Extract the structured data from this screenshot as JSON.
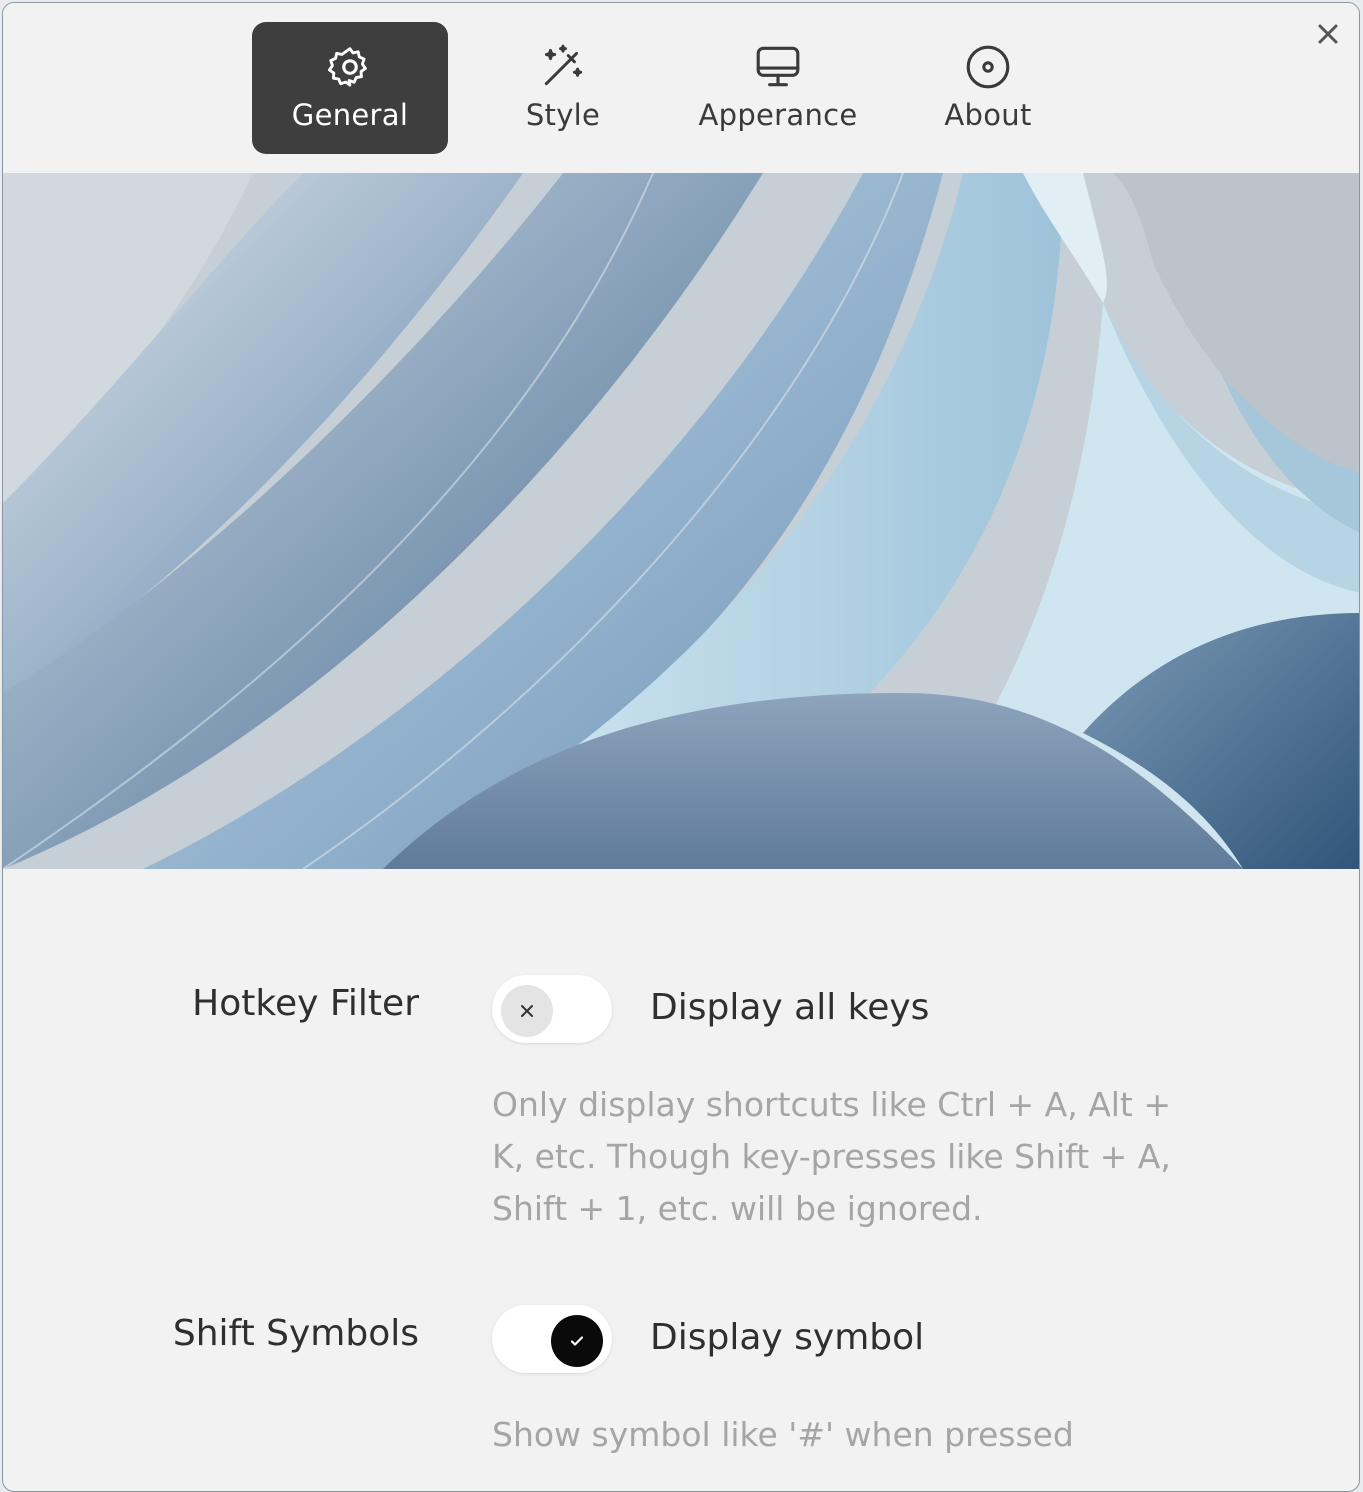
{
  "tabs": [
    {
      "id": "general",
      "label": "General",
      "icon": "gear-icon",
      "active": true
    },
    {
      "id": "style",
      "label": "Style",
      "icon": "magic-wand-icon",
      "active": false
    },
    {
      "id": "appearance",
      "label": "Apperance",
      "icon": "monitor-icon",
      "active": false
    },
    {
      "id": "about",
      "label": "About",
      "icon": "disc-icon",
      "active": false
    }
  ],
  "settings": {
    "hotkey_filter": {
      "label": "Hotkey Filter",
      "toggle_text": "Display all keys",
      "enabled": false,
      "description": "Only display shortcuts like Ctrl + A, Alt + K, etc. Though key-presses like Shift + A, Shift + 1, etc. will be ignored."
    },
    "shift_symbols": {
      "label": "Shift Symbols",
      "toggle_text": "Display symbol",
      "enabled": true,
      "description": "Show symbol like '#' when pressed"
    }
  },
  "colors": {
    "active_tab_bg": "#3e3e3e",
    "window_bg": "#f2f2f2",
    "toggle_on_knob": "#0a0a0a",
    "toggle_off_knob": "#e4e4e4",
    "description_text": "#a5a5a5"
  }
}
